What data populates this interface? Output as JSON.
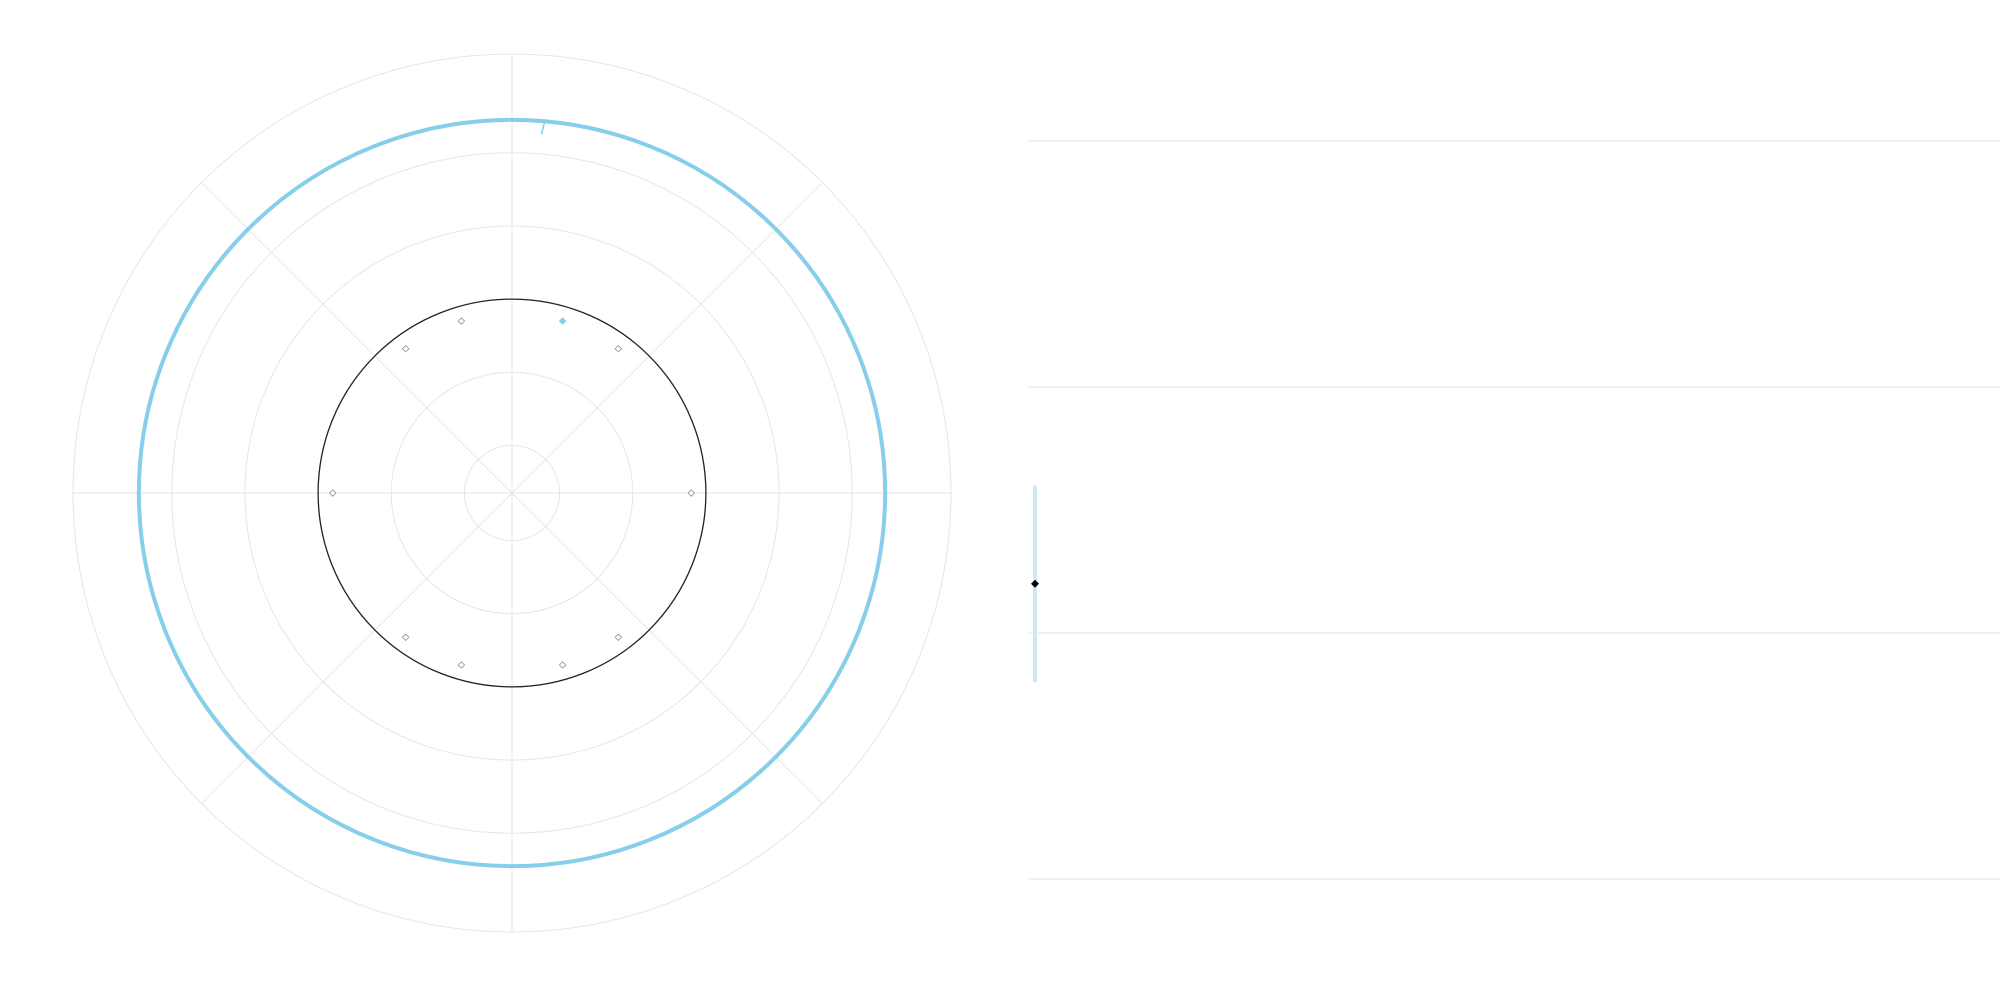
{
  "colors": {
    "grid": "#e6e6e6",
    "reference_circle": "#222222",
    "band": "#87ceeb",
    "band_light": "#cfe8f5",
    "marker": "#000000"
  },
  "chart_data": [
    {
      "type": "radial",
      "title": "",
      "rlim": [
        0,
        6
      ],
      "grid": true,
      "radial_gridlines": [
        0.65,
        1.65,
        2.65,
        3.65,
        4.65,
        6.0
      ],
      "spokes_deg": [
        0,
        45,
        90,
        135,
        180,
        225,
        270,
        315
      ],
      "reference_circle_r": 2.65,
      "marker_ring_r": 2.45,
      "marker_angles_deg": [
        16.4,
        343.6,
        36.4,
        323.6,
        90,
        270,
        143.6,
        216.4,
        163.6,
        196.4
      ],
      "highlighted_marker_angle_deg": 16.4,
      "band_circle_r": 5.1,
      "band_tick_angle_deg": 5
    },
    {
      "type": "line",
      "title": "",
      "xlabel": "",
      "ylabel": "",
      "grid": true,
      "horizontal_gridlines": 4,
      "points": [
        {
          "x": 0,
          "y": 0.2,
          "error_low": -0.2,
          "error_high": 0.6
        }
      ]
    }
  ]
}
